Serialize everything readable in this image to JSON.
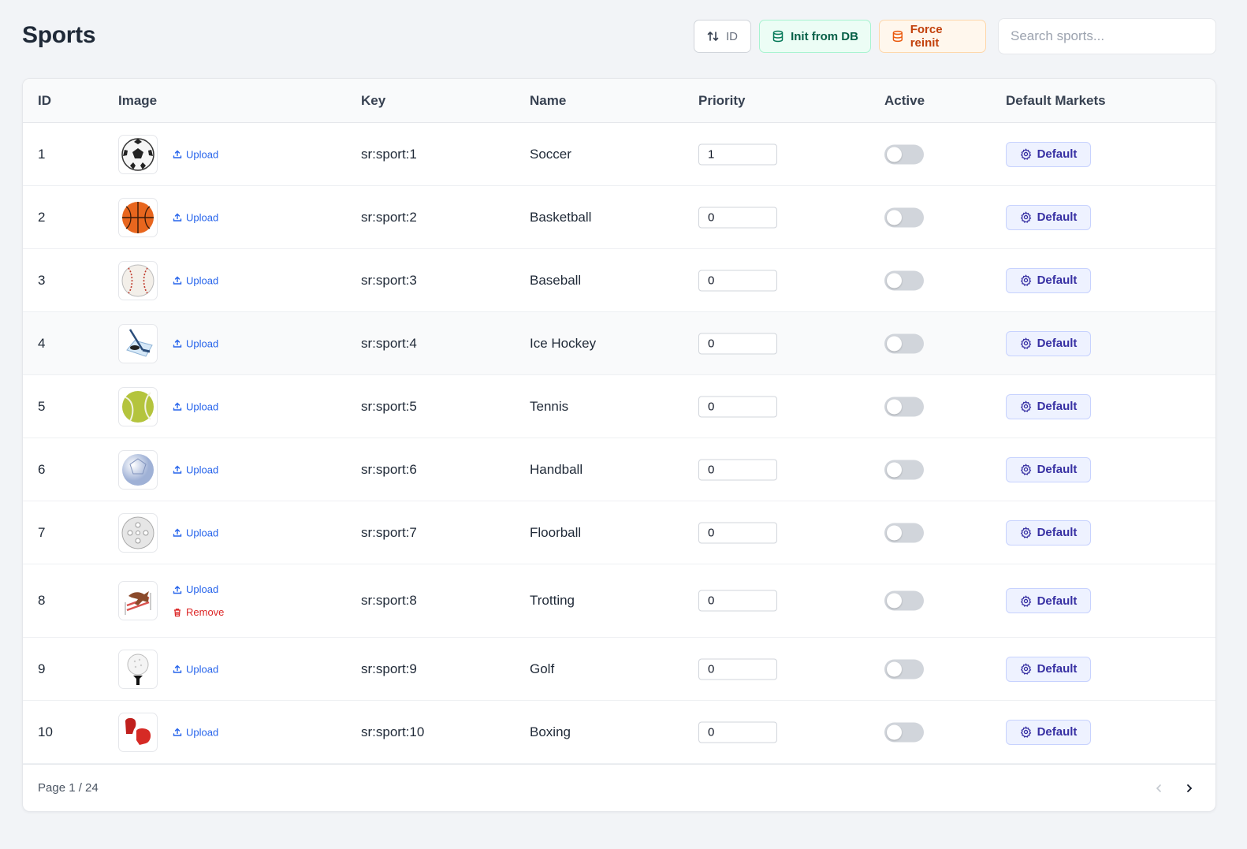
{
  "page": {
    "title": "Sports"
  },
  "toolbar": {
    "sort_label": "ID",
    "init_label": "Init from DB",
    "force_label": "Force reinit",
    "search_placeholder": "Search sports...",
    "search_value": ""
  },
  "table": {
    "headers": {
      "id": "ID",
      "image": "Image",
      "key": "Key",
      "name": "Name",
      "priority": "Priority",
      "active": "Active",
      "markets": "Default Markets"
    },
    "upload_label": "Upload",
    "remove_label": "Remove",
    "default_label": "Default",
    "rows": [
      {
        "id": "1",
        "key": "sr:sport:1",
        "name": "Soccer",
        "priority": "1",
        "active": false,
        "icon": "soccer-ball-icon",
        "removable": false
      },
      {
        "id": "2",
        "key": "sr:sport:2",
        "name": "Basketball",
        "priority": "0",
        "active": false,
        "icon": "basketball-icon",
        "removable": false
      },
      {
        "id": "3",
        "key": "sr:sport:3",
        "name": "Baseball",
        "priority": "0",
        "active": false,
        "icon": "baseball-icon",
        "removable": false
      },
      {
        "id": "4",
        "key": "sr:sport:4",
        "name": "Ice Hockey",
        "priority": "0",
        "active": false,
        "icon": "ice-hockey-icon",
        "removable": false
      },
      {
        "id": "5",
        "key": "sr:sport:5",
        "name": "Tennis",
        "priority": "0",
        "active": false,
        "icon": "tennis-ball-icon",
        "removable": false
      },
      {
        "id": "6",
        "key": "sr:sport:6",
        "name": "Handball",
        "priority": "0",
        "active": false,
        "icon": "handball-icon",
        "removable": false
      },
      {
        "id": "7",
        "key": "sr:sport:7",
        "name": "Floorball",
        "priority": "0",
        "active": false,
        "icon": "floorball-icon",
        "removable": false
      },
      {
        "id": "8",
        "key": "sr:sport:8",
        "name": "Trotting",
        "priority": "0",
        "active": false,
        "icon": "horse-jump-icon",
        "removable": true
      },
      {
        "id": "9",
        "key": "sr:sport:9",
        "name": "Golf",
        "priority": "0",
        "active": false,
        "icon": "golf-ball-icon",
        "removable": false
      },
      {
        "id": "10",
        "key": "sr:sport:10",
        "name": "Boxing",
        "priority": "0",
        "active": false,
        "icon": "boxing-gloves-icon",
        "removable": false
      }
    ]
  },
  "pagination": {
    "label": "Page 1 / 24"
  },
  "colors": {
    "upload": "#2563eb",
    "remove": "#dc2626",
    "accent": "#3730a3"
  }
}
